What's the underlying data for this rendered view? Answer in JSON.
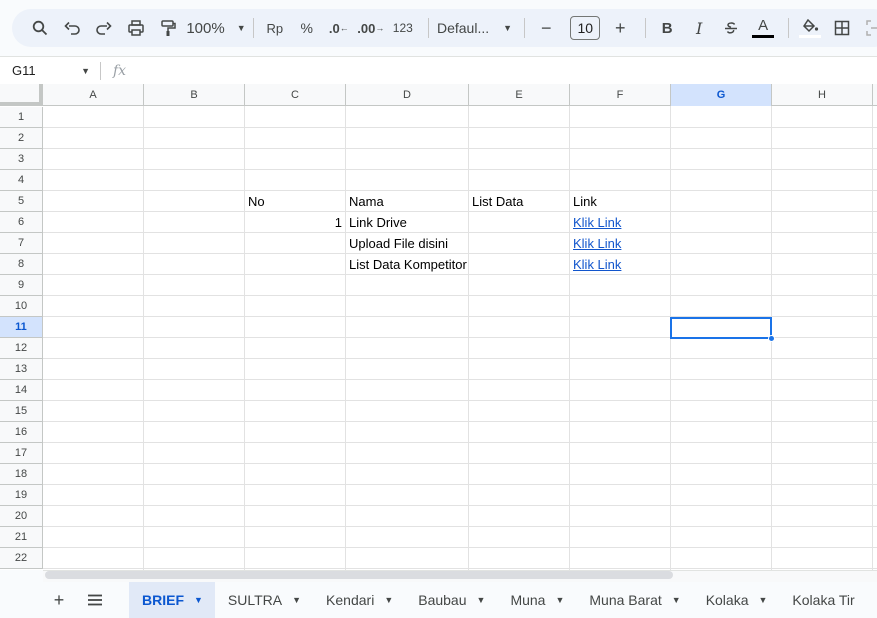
{
  "toolbar": {
    "zoom": "100%",
    "currency": "Rp",
    "percent": "%",
    "dec_decrease": ".0",
    "dec_increase": ".00",
    "number_format": "123",
    "font_name": "Defaul...",
    "font_size": "10",
    "bold": "B",
    "italic": "I",
    "text_color_letter": "A"
  },
  "formula_bar": {
    "name_box": "G11",
    "fx_label": "fx",
    "value": ""
  },
  "grid": {
    "columns": [
      "A",
      "B",
      "C",
      "D",
      "E",
      "F",
      "G",
      "H"
    ],
    "selected_column": "G",
    "rows": [
      "1",
      "2",
      "3",
      "4",
      "5",
      "6",
      "7",
      "8",
      "9",
      "10",
      "11",
      "12",
      "13",
      "14",
      "15",
      "16",
      "17",
      "18",
      "19",
      "20",
      "21",
      "22"
    ],
    "selected_row": "11",
    "cells": {
      "C5": "No",
      "D5": "Nama",
      "E5": "List Data",
      "F5": "Link",
      "C6": "1",
      "D6": "Link Drive",
      "F6": "Klik Link",
      "D7": "Upload File disini",
      "F7": "Klik Link",
      "D8": "List Data Kompetitor",
      "F8": "Klik Link"
    }
  },
  "sheets": {
    "tabs": [
      "BRIEF",
      "SULTRA",
      "Kendari",
      "Baubau",
      "Muna",
      "Muna Barat",
      "Kolaka",
      "Kolaka Tir"
    ],
    "active": "BRIEF"
  },
  "colors": {
    "accent": "#1a73e8",
    "link": "#1155cc",
    "toolbar_bg": "#edf2fa",
    "active_tab_bg": "#e1e9f7"
  }
}
